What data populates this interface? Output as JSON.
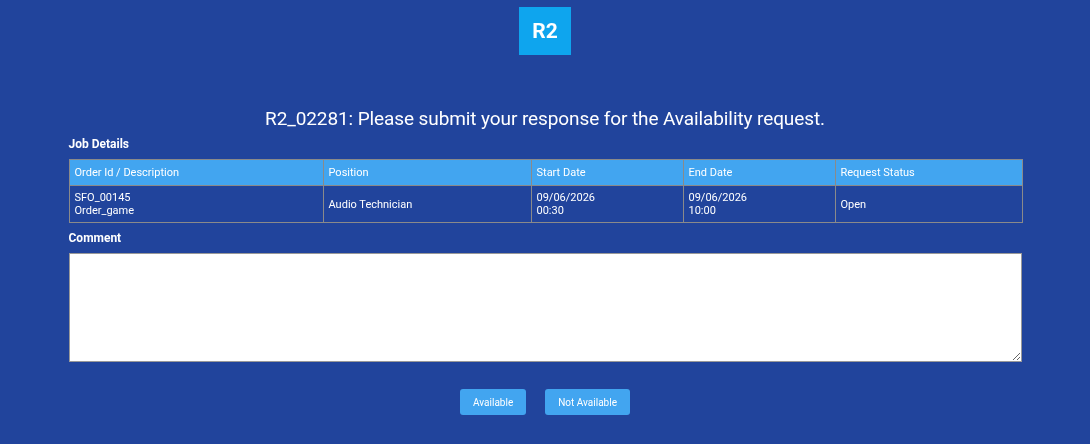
{
  "logo": {
    "text": "R2"
  },
  "title": "R2_02281: Please submit your response for the Availability request.",
  "job_details": {
    "heading": "Job Details",
    "columns": [
      "Order Id / Description",
      "Position",
      "Start Date",
      "End Date",
      "Request Status"
    ],
    "rows": [
      [
        [
          "SFO_00145",
          "Order_game"
        ],
        [
          "Audio Technician"
        ],
        [
          "09/06/2026",
          "00:30"
        ],
        [
          "09/06/2026",
          "10:00"
        ],
        [
          "Open"
        ]
      ]
    ]
  },
  "comment": {
    "label": "Comment"
  },
  "buttons": [
    "Available",
    "Not Available"
  ]
}
